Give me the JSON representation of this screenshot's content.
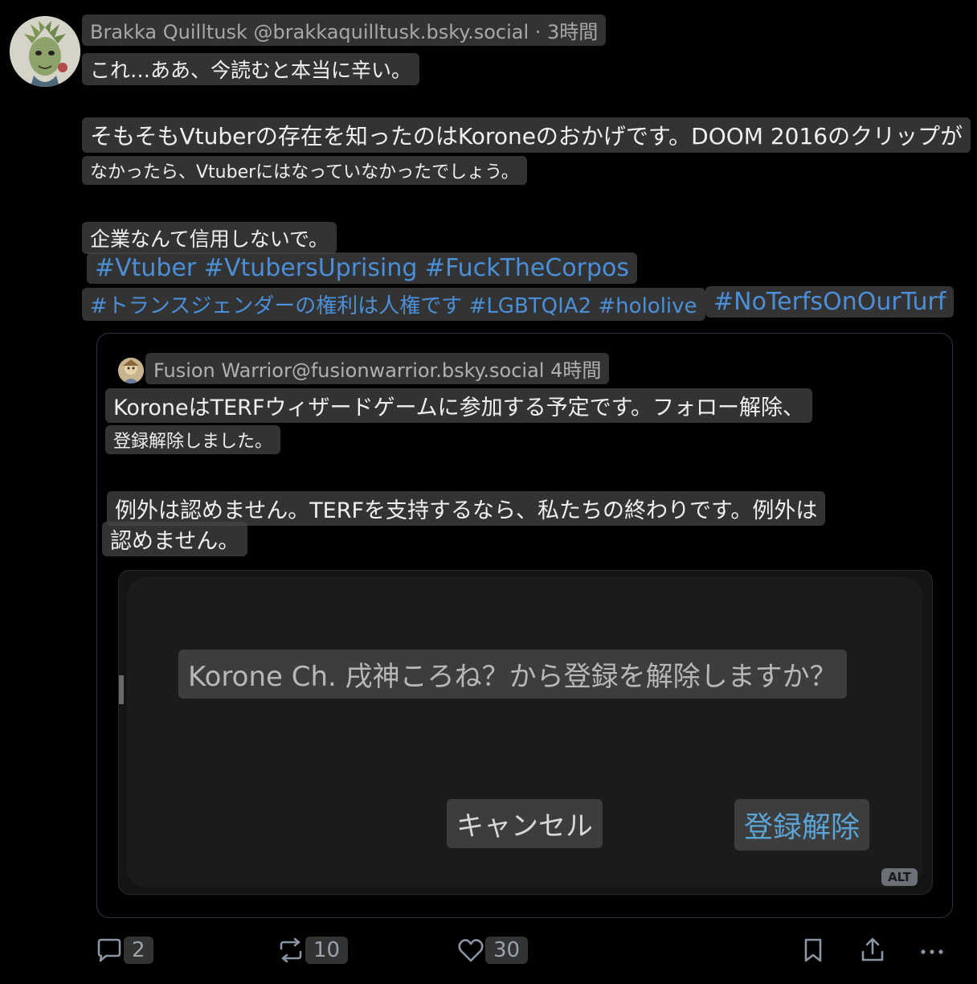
{
  "post": {
    "author_line": "Brakka Quilltusk @brakkaquilltusk.bsky.social · 3時間",
    "line1": "これ…ああ、今読むと本当に辛い。",
    "line2a": "そもそもVtuberの存在を知ったのはKoroneのおかげです。DOOM 2016のクリップが",
    "line2b": "なかったら、Vtuberにはなっていなかったでしょう。",
    "line3": "企業なんて信用しないで。",
    "tags1": "#Vtuber #VtubersUprising #FuckTheCorpos",
    "tags2": "#トランスジェンダーの権利は人権です #LGBTQIA2 #hololive",
    "tags3": "#NoTerfsOnOurTurf"
  },
  "quote": {
    "author_line": "Fusion Warrior@fusionwarrior.bsky.social 4時間",
    "line1a": "KoroneはTERFウィザードゲームに参加する予定です。フォロー解除、",
    "line1b": "登録解除しました。",
    "line2a": "例外は認めません。TERFを支持するなら、私たちの終わりです。例外は",
    "line2b": "認めません。",
    "image": {
      "dialog_question": "Korone Ch. 戌神ころね？から登録を解除しますか？",
      "cancel_label": "キャンセル",
      "unsubscribe_label": "登録解除",
      "alt_badge": "ALT"
    }
  },
  "actions": {
    "reply_count": "2",
    "repost_count": "10",
    "like_count": "30"
  },
  "icons": {
    "reply": "reply-icon",
    "repost": "repost-icon",
    "like": "heart-icon",
    "bookmark": "bookmark-icon",
    "share": "share-icon",
    "more": "more-icon"
  },
  "colors": {
    "background": "#000000",
    "hashtag": "#4a8fd8",
    "unsubscribe_button": "#5aa4d6",
    "icon": "#8a95a3"
  }
}
